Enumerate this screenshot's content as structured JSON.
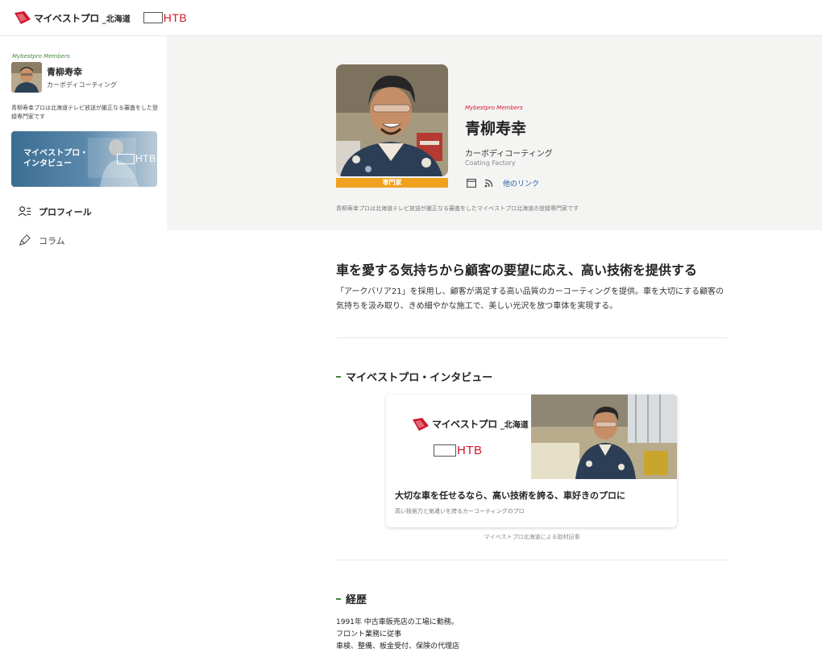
{
  "header": {
    "logo_text": "マイベストプロ",
    "logo_region": "_北海道",
    "partner": "HTB"
  },
  "sidebar": {
    "members_label": "Mybestpro Members",
    "name": "青柳寿幸",
    "category": "カーボディコーティング",
    "description": "青柳寿幸プロは北海道テレビ放送が厳正なる審査をした登録専門家です",
    "banner_text_line1": "マイベストプロ・",
    "banner_text_line2": "インタビュー",
    "banner_partner": "HTB",
    "nav": [
      {
        "label": "プロフィール",
        "icon": "person-list-icon"
      },
      {
        "label": "コラム",
        "icon": "pen-icon"
      }
    ]
  },
  "profile": {
    "badge": "専門家",
    "members_label": "Mybestpro Members",
    "name": "青柳寿幸",
    "category": "カーボディコーティング",
    "company": "Coating Factory",
    "other_link": "他のリンク",
    "note": "青柳寿幸プロは北海道テレビ放送が厳正なる審査をしたマイベストプロ北海道の登録専門家です"
  },
  "main": {
    "headline": "車を愛する気持ちから顧客の要望に応え、高い技術を提供する",
    "lead": "「アークバリア21」を採用し、顧客が満足する高い品質のカーコーティングを提供。車を大切にする顧客の気持ちを汲み取り、きめ細やかな施工で、美しい光沢を放つ車体を実現する。",
    "interview_section": "マイベストプロ・インタビュー",
    "card": {
      "logo_text": "マイベストプロ",
      "logo_region": "_北海道",
      "partner": "HTB",
      "title": "大切な車を任せるなら、高い技術を誇る、車好きのプロに",
      "subtitle": "高い技術力と気遣いを誇るカーコーティングのプロ"
    },
    "caption": "マイベストプロ北海道による取材記事",
    "career_section": "経歴",
    "career_lines": [
      "1991年 中古車販売店の工場に勤務。",
      "フロント業務に従事",
      "車検、整備、板金受付、保険の代理店"
    ]
  },
  "colors": {
    "brand_red": "#d0162b",
    "accent_green": "#3f8a3a",
    "badge_orange": "#f0a21f",
    "link_blue": "#1f5fa8"
  }
}
